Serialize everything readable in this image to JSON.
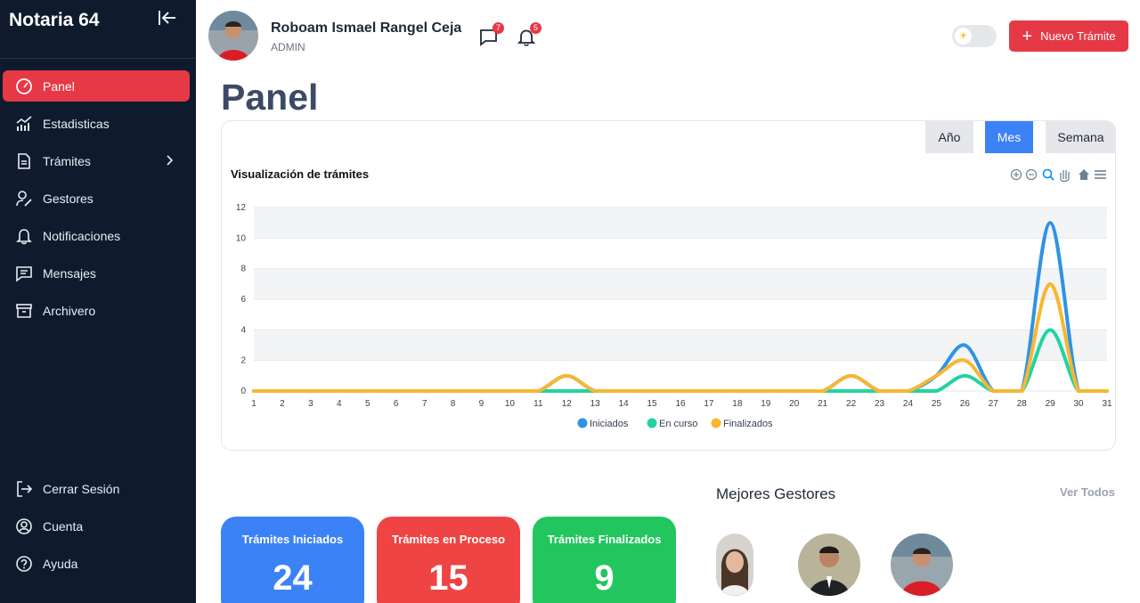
{
  "sidebar": {
    "brand": "Notaria 64",
    "items": [
      {
        "label": "Panel",
        "icon": "gauge-icon",
        "active": true
      },
      {
        "label": "Estadisticas",
        "icon": "bar-chart-icon"
      },
      {
        "label": "Trámites",
        "icon": "document-icon",
        "has_submenu": true
      },
      {
        "label": "Gestores",
        "icon": "user-edit-icon"
      },
      {
        "label": "Notificaciones",
        "icon": "bell-icon"
      },
      {
        "label": "Mensajes",
        "icon": "message-icon"
      },
      {
        "label": "Archivero",
        "icon": "archive-icon"
      }
    ],
    "bottom_items": [
      {
        "label": "Cerrar Sesión",
        "icon": "logout-icon"
      },
      {
        "label": "Cuenta",
        "icon": "user-circle-icon"
      },
      {
        "label": "Ayuda",
        "icon": "help-icon"
      }
    ]
  },
  "header": {
    "user_name": "Roboam Ismael Rangel Ceja",
    "user_role": "ADMIN",
    "messages_count": "7",
    "notifications_count": "5",
    "new_button_label": "Nuevo Trámite"
  },
  "page": {
    "title": "Panel"
  },
  "chart_card": {
    "tabs": [
      "Año",
      "Mes",
      "Semana"
    ],
    "active_tab": "Mes"
  },
  "chart_data": {
    "type": "area",
    "title": "Visualización de trámites",
    "x": [
      1,
      2,
      3,
      4,
      5,
      6,
      7,
      8,
      9,
      10,
      11,
      12,
      13,
      14,
      15,
      16,
      17,
      18,
      19,
      20,
      21,
      22,
      23,
      24,
      25,
      26,
      27,
      28,
      29,
      30,
      31
    ],
    "ylim": [
      0,
      12
    ],
    "yticks": [
      0,
      2,
      4,
      6,
      8,
      10,
      12
    ],
    "grid": true,
    "legend_position": "bottom",
    "series": [
      {
        "name": "Iniciados",
        "color": "#2e93e6",
        "values": [
          0,
          0,
          0,
          0,
          0,
          0,
          0,
          0,
          0,
          0,
          0,
          1,
          0,
          0,
          0,
          0,
          0,
          0,
          0,
          0,
          0,
          1,
          0,
          0,
          1,
          3,
          0,
          0,
          11,
          0,
          0
        ]
      },
      {
        "name": "En curso",
        "color": "#22d3a0",
        "values": [
          0,
          0,
          0,
          0,
          0,
          0,
          0,
          0,
          0,
          0,
          0,
          0,
          0,
          0,
          0,
          0,
          0,
          0,
          0,
          0,
          0,
          0,
          0,
          0,
          0,
          1,
          0,
          0,
          4,
          0,
          0
        ]
      },
      {
        "name": "Finalizados",
        "color": "#f7b731",
        "values": [
          0,
          0,
          0,
          0,
          0,
          0,
          0,
          0,
          0,
          0,
          0,
          1,
          0,
          0,
          0,
          0,
          0,
          0,
          0,
          0,
          0,
          1,
          0,
          0,
          1,
          2,
          0,
          0,
          7,
          0,
          0
        ]
      }
    ]
  },
  "stats": [
    {
      "label": "Trámites Iniciados",
      "value": "24",
      "color": "#3b82f6"
    },
    {
      "label": "Trámites en Proceso",
      "value": "15",
      "color": "#ef4444"
    },
    {
      "label": "Trámites Finalizados",
      "value": "9",
      "color": "#22c55e"
    }
  ],
  "best_managers": {
    "title": "Mejores Gestores",
    "see_all": "Ver Todos"
  }
}
